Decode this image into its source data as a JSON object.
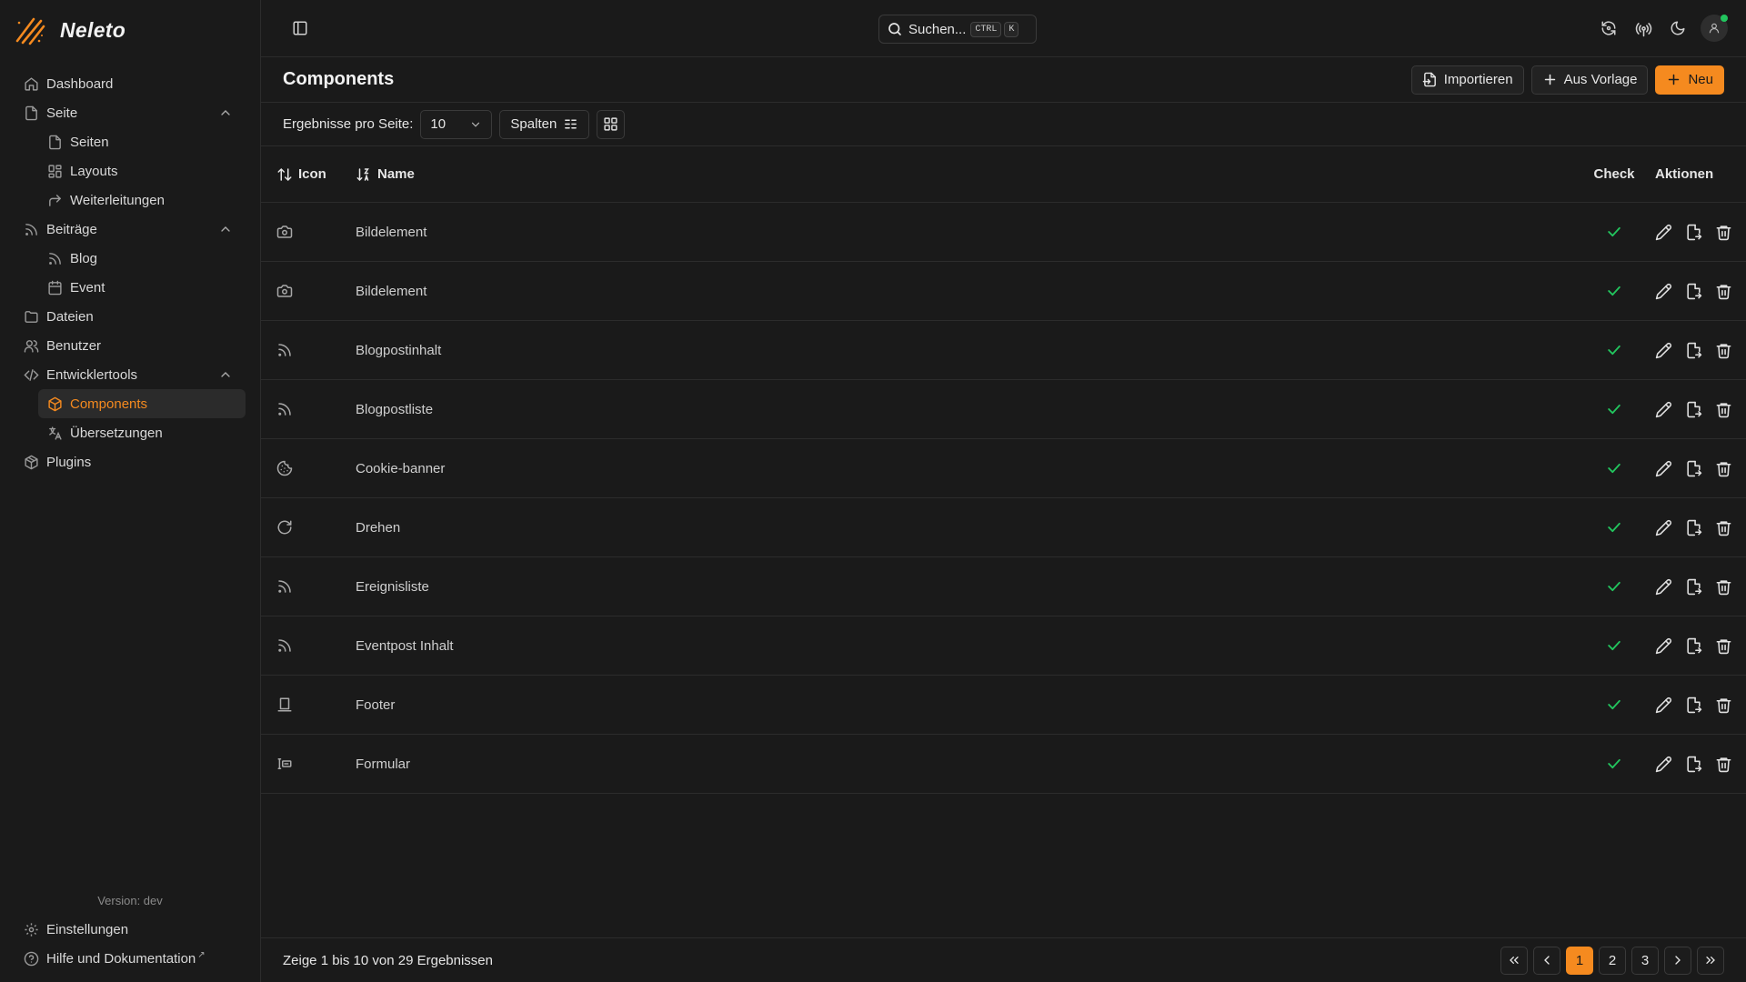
{
  "app": {
    "name": "Neleto"
  },
  "colors": {
    "accent": "#f58a1f",
    "success": "#22c55e",
    "background": "#1a1a1a",
    "border": "#2c2c2c"
  },
  "sidebar": {
    "items": [
      {
        "label": "Dashboard",
        "icon": "home-icon"
      },
      {
        "label": "Seite",
        "icon": "file-icon",
        "expanded": true
      },
      {
        "label": "Seiten",
        "icon": "file-icon"
      },
      {
        "label": "Layouts",
        "icon": "layout-icon"
      },
      {
        "label": "Weiterleitungen",
        "icon": "redirect-icon"
      },
      {
        "label": "Beiträge",
        "icon": "rss-icon",
        "expanded": true
      },
      {
        "label": "Blog",
        "icon": "rss-icon"
      },
      {
        "label": "Event",
        "icon": "calendar-icon"
      },
      {
        "label": "Dateien",
        "icon": "folder-icon"
      },
      {
        "label": "Benutzer",
        "icon": "users-icon"
      },
      {
        "label": "Entwicklertools",
        "icon": "code-icon",
        "expanded": true
      },
      {
        "label": "Components",
        "icon": "box-icon",
        "active": true
      },
      {
        "label": "Übersetzungen",
        "icon": "translate-icon"
      },
      {
        "label": "Plugins",
        "icon": "package-icon"
      }
    ],
    "version": "Version: dev",
    "settings_label": "Einstellungen",
    "help_label": "Hilfe und Dokumentation"
  },
  "topbar": {
    "search_label": "Suchen...",
    "kbd_ctrl": "CTRL",
    "kbd_k": "K"
  },
  "page": {
    "title": "Components",
    "import_label": "Importieren",
    "template_label": "Aus Vorlage",
    "new_label": "Neu"
  },
  "toolbar": {
    "per_page_label": "Ergebnisse pro Seite:",
    "per_page_value": "10",
    "columns_label": "Spalten"
  },
  "table": {
    "headers": {
      "icon": "Icon",
      "name": "Name",
      "check": "Check",
      "actions": "Aktionen"
    },
    "rows": [
      {
        "icon": "camera-icon",
        "name": "Bildelement",
        "check": true
      },
      {
        "icon": "camera-icon",
        "name": "Bildelement",
        "check": true
      },
      {
        "icon": "rss-icon",
        "name": "Blogpostinhalt",
        "check": true
      },
      {
        "icon": "rss-icon",
        "name": "Blogpostliste",
        "check": true
      },
      {
        "icon": "cookie-icon",
        "name": "Cookie-banner",
        "check": true
      },
      {
        "icon": "rotate-icon",
        "name": "Drehen",
        "check": true
      },
      {
        "icon": "rss-icon",
        "name": "Ereignisliste",
        "check": true
      },
      {
        "icon": "rss-icon",
        "name": "Eventpost Inhalt",
        "check": true
      },
      {
        "icon": "footer-icon",
        "name": "Footer",
        "check": true
      },
      {
        "icon": "form-icon",
        "name": "Formular",
        "check": true
      }
    ]
  },
  "footer": {
    "summary": "Zeige 1 bis 10 von 29 Ergebnissen",
    "pages": [
      "1",
      "2",
      "3"
    ],
    "current_page": "1"
  }
}
